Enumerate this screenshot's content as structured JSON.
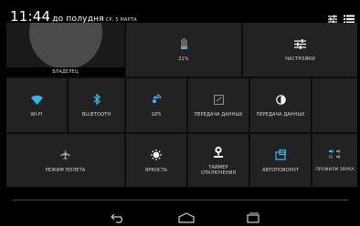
{
  "status": {
    "time": "11:44",
    "ampm": "до полудня",
    "date": "СР, 5 МАРТА"
  },
  "owner": {
    "label": "ВЛАДЕЛЕЦ"
  },
  "battery": {
    "label": "21%"
  },
  "settings": {
    "label": "НАСТРОЙКИ"
  },
  "tiles": {
    "wifi": "WI-FI",
    "bluetooth": "BLUETOOTH",
    "gps": "GPS",
    "data1": "ПЕРЕДАЧА ДАННЫХ",
    "data2": "ПЕРЕДАЧА ДАННЫХ",
    "airplane": "РЕЖИМ ПОЛЕТА",
    "brightness": "ЯРКОСТЬ",
    "sleep": "ТАЙМЕР ОТКЛЮЧЕНИЯ",
    "rotate": "АВТОПОВОРОТ",
    "sound": "ПРОФИЛИ ЗВУКА"
  },
  "colors": {
    "accent": "#33b5e5",
    "tile": "#222222",
    "panel": "#0d0d0d"
  }
}
